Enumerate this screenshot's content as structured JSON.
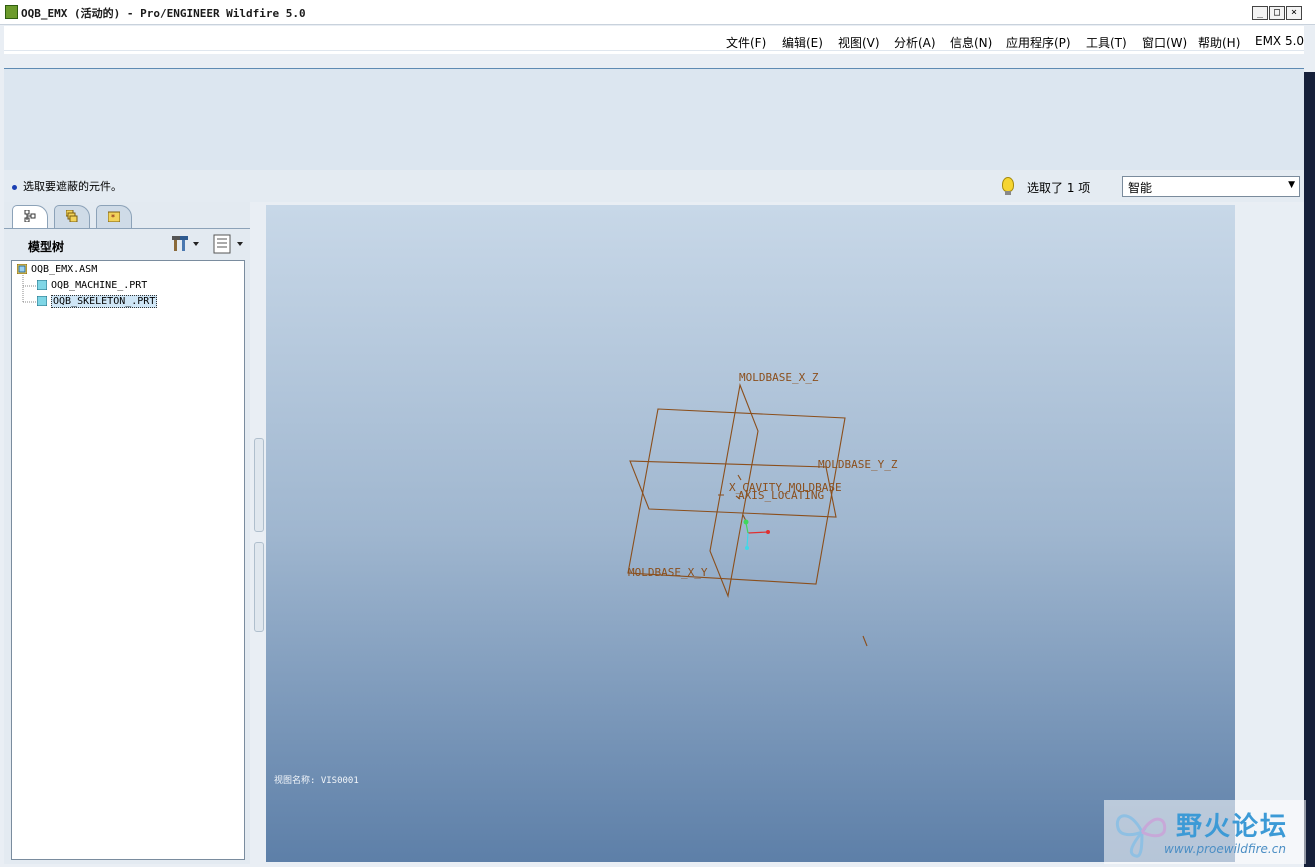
{
  "window": {
    "title": "OQB_EMX (活动的) - Pro/ENGINEER Wildfire 5.0",
    "controls": [
      "_",
      "□",
      "×"
    ]
  },
  "menu": [
    "文件(F)",
    "编辑(E)",
    "视图(V)",
    "分析(A)",
    "信息(N)",
    "应用程序(P)",
    "工具(T)",
    "窗口(W)",
    "帮助(H)",
    "EMX 5.0"
  ],
  "status": {
    "message": "选取要遮蔽的元件。",
    "selection_count": "选取了 1 项",
    "filter_value": "智能"
  },
  "model_tree": {
    "title": "模型树",
    "items": [
      {
        "label": "OQB_EMX.ASM",
        "type": "assembly",
        "level": 0
      },
      {
        "label": "OQB_MACHINE_.PRT",
        "type": "part",
        "level": 1
      },
      {
        "label": "OQB_SKELETON_.PRT",
        "type": "part",
        "level": 1,
        "selected": true
      }
    ]
  },
  "graphics": {
    "datum_labels": [
      "MOLDBASE_X_Z",
      "MOLDBASE_Y_Z",
      "X_CAVITY_MOLDBASE",
      "AXIS_LOCATING",
      "MOLDBASE_X_Y"
    ],
    "view_name": "视图名称: VIS0001",
    "datum_color": "#8b4f1c",
    "background_top": "#c8d8e8",
    "background_bottom": "#5d7fa8"
  },
  "watermark": {
    "title": "野火论坛",
    "url": "www.proewildfire.cn"
  }
}
